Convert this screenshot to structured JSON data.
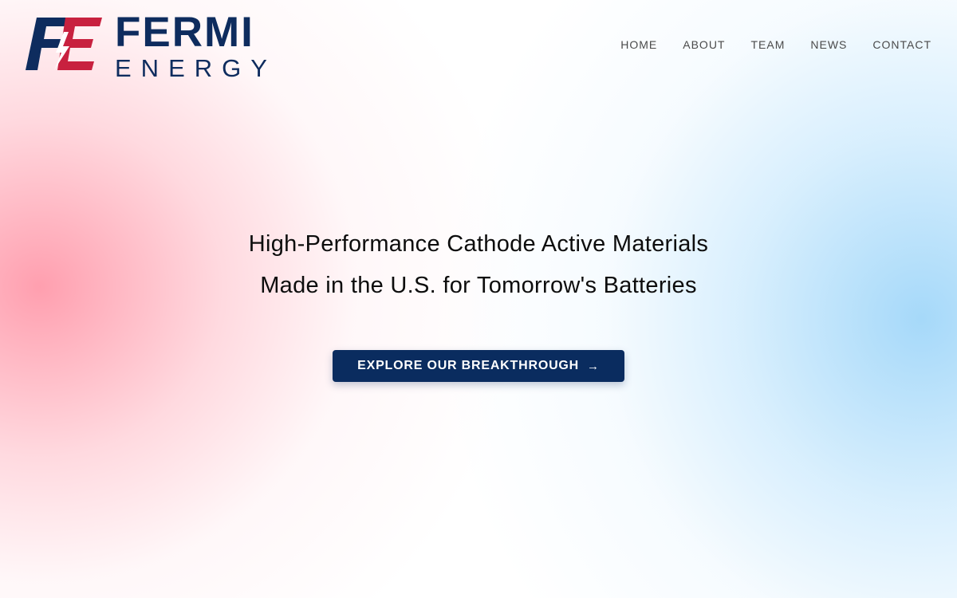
{
  "brand": {
    "line1": "FERMI",
    "line2": "ENERGY",
    "mark_letters": "FE",
    "colors": {
      "navy": "#0e2c5e",
      "crimson": "#c8213f",
      "button": "#0a2c5f"
    }
  },
  "nav": {
    "items": [
      {
        "label": "HOME"
      },
      {
        "label": "ABOUT"
      },
      {
        "label": "TEAM"
      },
      {
        "label": "NEWS"
      },
      {
        "label": "CONTACT"
      }
    ]
  },
  "hero": {
    "line1": "High-Performance Cathode Active Materials",
    "line2": "Made in the U.S. for Tomorrow's Batteries"
  },
  "cta": {
    "label": "EXPLORE OUR BREAKTHROUGH",
    "icon": "arrow-right-icon"
  }
}
